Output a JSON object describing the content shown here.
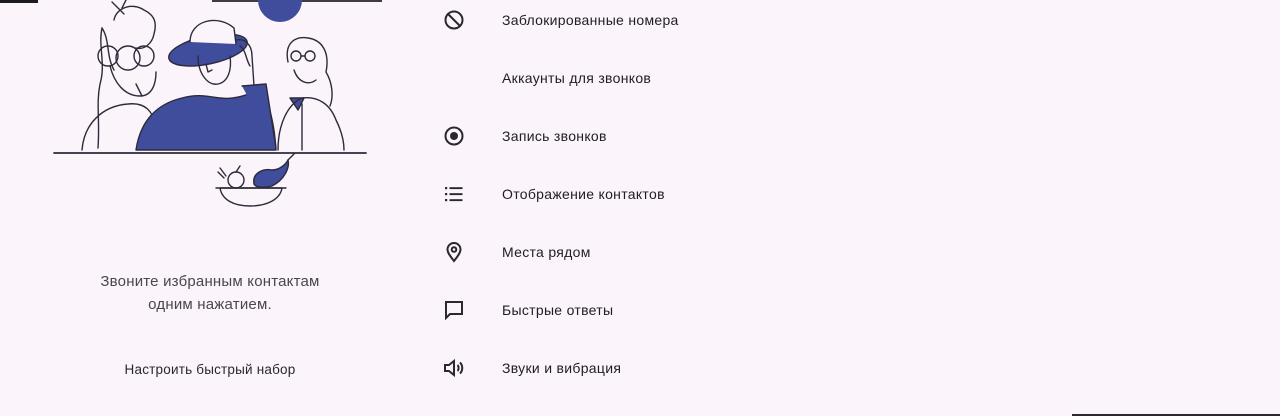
{
  "colors": {
    "background": "#fbf4fb",
    "illustration_ink": "#2d2a3a",
    "illustration_fill": "#3f4d9c"
  },
  "favorites_empty": {
    "illustration_icon": "people-at-table-illustration",
    "message": "Звоните избранным контактам одним нажатием.",
    "setup_link": "Настроить быстрый набор"
  },
  "settings": {
    "items": [
      {
        "icon": "block-icon",
        "label": "Заблокированные номера"
      },
      {
        "icon": "",
        "label": "Аккаунты для звонков"
      },
      {
        "icon": "record-icon",
        "label": "Запись звонков"
      },
      {
        "icon": "list-icon",
        "label": "Отображение контактов"
      },
      {
        "icon": "location-pin-icon",
        "label": "Места рядом"
      },
      {
        "icon": "chat-bubble-icon",
        "label": "Быстрые ответы"
      },
      {
        "icon": "volume-icon",
        "label": "Звуки и вибрация"
      }
    ]
  }
}
